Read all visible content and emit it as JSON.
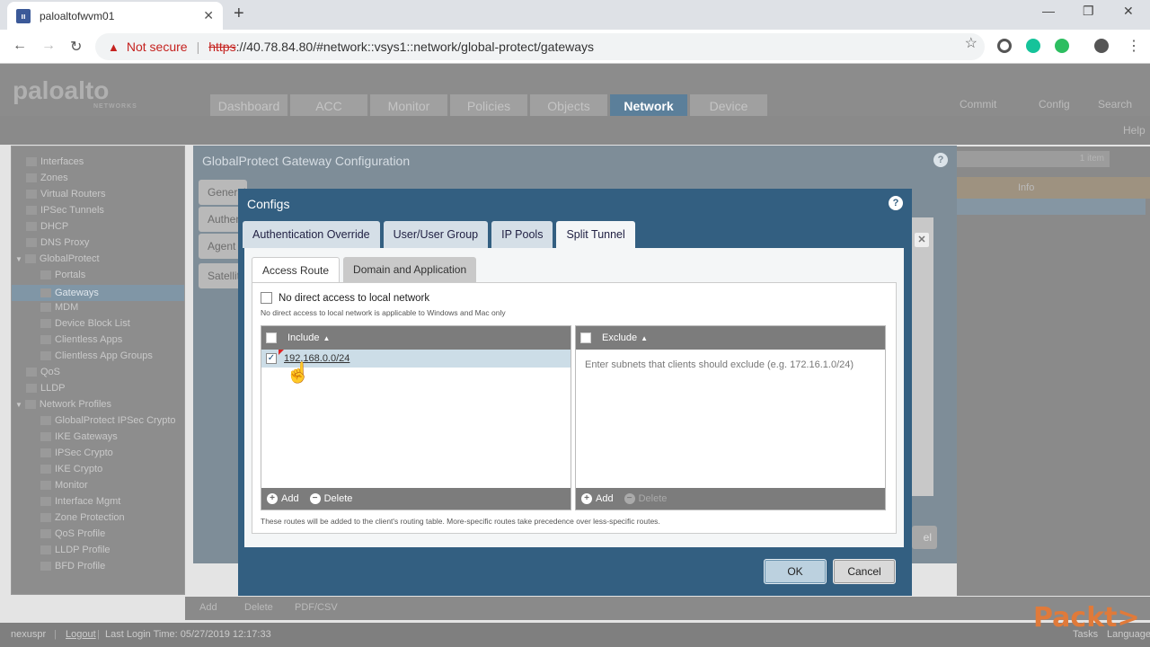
{
  "browser": {
    "tab_title": "paloaltofwvm01",
    "not_secure": "Not secure",
    "url_scheme": "https",
    "url_rest": "://40.78.84.80/#network::vsys1::network/global-protect/gateways"
  },
  "app": {
    "logo": "paloalto",
    "logo_sub": "NETWORKS",
    "main_tabs": [
      {
        "label": "Dashboard"
      },
      {
        "label": "ACC"
      },
      {
        "label": "Monitor"
      },
      {
        "label": "Policies"
      },
      {
        "label": "Objects"
      },
      {
        "label": "Network"
      },
      {
        "label": "Device"
      }
    ],
    "header_right": {
      "commit": "Commit",
      "config": "Config",
      "search": "Search",
      "help": "Help"
    },
    "sidebar": [
      {
        "label": "Interfaces"
      },
      {
        "label": "Zones"
      },
      {
        "label": "Virtual Routers"
      },
      {
        "label": "IPSec Tunnels"
      },
      {
        "label": "DHCP"
      },
      {
        "label": "DNS Proxy"
      },
      {
        "label": "GlobalProtect"
      },
      {
        "label": "Portals"
      },
      {
        "label": "Gateways"
      },
      {
        "label": "MDM"
      },
      {
        "label": "Device Block List"
      },
      {
        "label": "Clientless Apps"
      },
      {
        "label": "Clientless App Groups"
      },
      {
        "label": "QoS"
      },
      {
        "label": "LLDP"
      },
      {
        "label": "Network Profiles"
      },
      {
        "label": "GlobalProtect IPSec Crypto"
      },
      {
        "label": "IKE Gateways"
      },
      {
        "label": "IPSec Crypto"
      },
      {
        "label": "IKE Crypto"
      },
      {
        "label": "Monitor"
      },
      {
        "label": "Interface Mgmt"
      },
      {
        "label": "Zone Protection"
      },
      {
        "label": "QoS Profile"
      },
      {
        "label": "LLDP Profile"
      },
      {
        "label": "BFD Profile"
      }
    ],
    "right_panel": {
      "count": "1 item",
      "col_info": "Info"
    },
    "footer": {
      "add": "Add",
      "delete": "Delete",
      "pdf": "PDF/CSV"
    },
    "status": {
      "user": "nexuspr",
      "logout": "Logout",
      "last_login": "Last Login Time: 05/27/2019 12:17:33",
      "tasks": "Tasks",
      "language": "Language"
    }
  },
  "outer_dialog": {
    "title": "GlobalProtect Gateway Configuration",
    "side_tabs": [
      "General",
      "Authen",
      "Agent",
      "Satellit"
    ],
    "button_fragment": "el"
  },
  "dialog": {
    "title": "Configs",
    "tabs": [
      {
        "label": "Authentication Override"
      },
      {
        "label": "User/User Group"
      },
      {
        "label": "IP Pools"
      },
      {
        "label": "Split Tunnel"
      }
    ],
    "subtabs": [
      {
        "label": "Access Route"
      },
      {
        "label": "Domain and Application"
      }
    ],
    "no_direct_label": "No direct access to local network",
    "no_direct_note": "No direct access to local network is applicable to Windows and Mac only",
    "include": {
      "header": "Include",
      "rows": [
        {
          "value": "192.168.0.0/24",
          "checked": true
        }
      ],
      "add": "Add",
      "delete": "Delete"
    },
    "exclude": {
      "header": "Exclude",
      "placeholder": "Enter subnets that clients should exclude (e.g. 172.16.1.0/24)",
      "add": "Add",
      "delete": "Delete"
    },
    "routes_note": "These routes will be added to the client's routing table. More-specific routes take precedence over less-specific routes.",
    "ok": "OK",
    "cancel": "Cancel"
  },
  "watermark": "Packt>"
}
